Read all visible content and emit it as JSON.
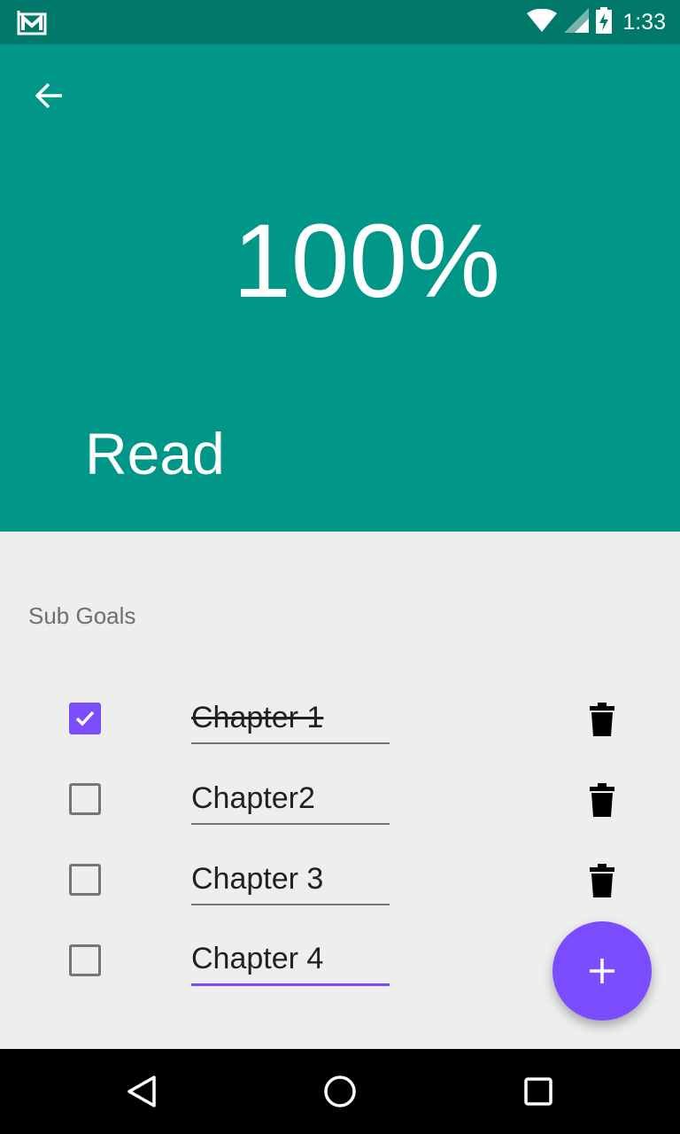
{
  "status_bar": {
    "time": "1:33",
    "icons": [
      "gmail-icon",
      "wifi-icon",
      "signal-icon",
      "battery-charging-icon"
    ]
  },
  "header": {
    "back_icon": "arrow-back-icon",
    "percent": "100%",
    "progress_fraction": 1.0,
    "goal_title": "Read",
    "color": "#009688"
  },
  "content": {
    "section_label": "Sub Goals",
    "subgoals": [
      {
        "label": "Chapter 1",
        "checked": true
      },
      {
        "label": "Chapter2",
        "checked": false
      },
      {
        "label": "Chapter 3",
        "checked": false
      },
      {
        "label": "Chapter 4",
        "checked": false
      }
    ]
  },
  "fab": {
    "icon": "plus-icon",
    "color": "#7c4dff"
  },
  "nav_bar": {
    "icons": [
      "back-triangle-icon",
      "home-circle-icon",
      "recents-square-icon"
    ]
  }
}
